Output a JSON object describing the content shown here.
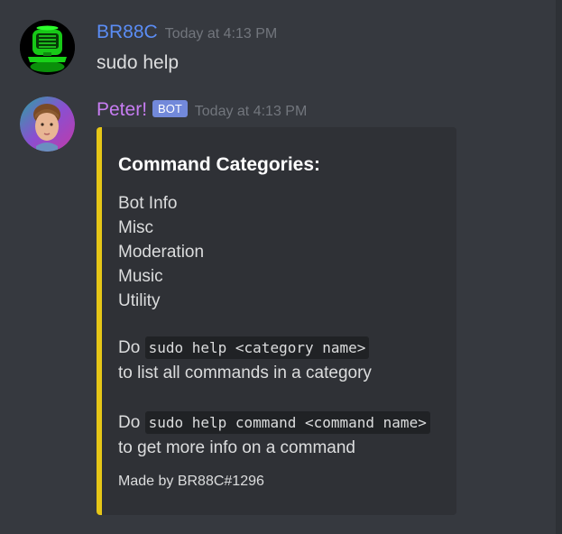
{
  "colors": {
    "background": "#36393f",
    "embed_background": "#2f3136",
    "embed_accent": "#e6c617",
    "user1_name": "#5b8df5",
    "user2_name": "#c77df2",
    "bot_tag": "#7289da",
    "timestamp": "#72767d"
  },
  "messages": [
    {
      "username": "BR88C",
      "timestamp": "Today at 4:13 PM",
      "avatar_icon": "green-robot-avatar",
      "text": "sudo help"
    },
    {
      "username": "Peter!",
      "bot_tag": "BOT",
      "timestamp": "Today at 4:13 PM",
      "avatar_icon": "boy-face-avatar",
      "embed": {
        "title": "Command Categories:",
        "categories": [
          "Bot Info",
          "Misc",
          "Moderation",
          "Music",
          "Utility"
        ],
        "para1_prefix": "Do",
        "para1_code": "sudo help <category name>",
        "para1_suffix": "to list all commands in a category",
        "para2_prefix": "Do",
        "para2_code": "sudo help command <command name>",
        "para2_suffix": "to get more info on a command",
        "footer": "Made by BR88C#1296"
      }
    }
  ]
}
